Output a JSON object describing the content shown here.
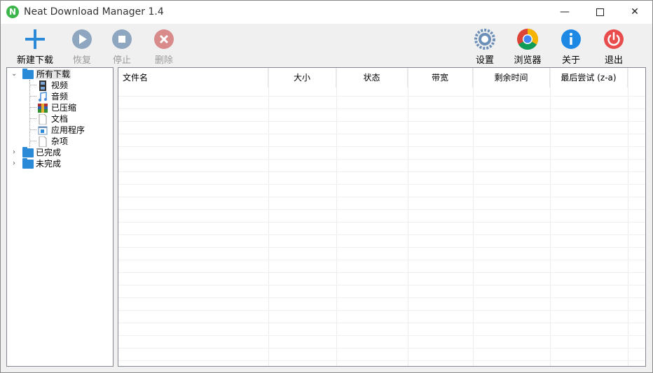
{
  "window": {
    "title": "Neat Download Manager 1.4",
    "app_icon_letter": "N",
    "controls": {
      "minimize": "—",
      "close": "✕"
    }
  },
  "toolbar": {
    "new_download": "新建下载",
    "resume": "恢复",
    "stop": "停止",
    "delete": "删除",
    "settings": "设置",
    "browser": "浏览器",
    "about": "关于",
    "exit": "退出"
  },
  "tree": {
    "all_downloads": "所有下载",
    "children": [
      "视频",
      "音频",
      "已压缩",
      "文档",
      "应用程序",
      "杂项"
    ],
    "completed": "已完成",
    "incomplete": "未完成"
  },
  "list": {
    "columns": [
      "文件名",
      "大小",
      "状态",
      "带宽",
      "剩余时间",
      "最后尝试 (z-a)"
    ]
  },
  "colors": {
    "accent_blue": "#2b8ad8",
    "disabled_icon": "#8fa6c0",
    "delete_red": "#d9534f",
    "exit_red": "#e84c4c",
    "info_blue": "#1e88e5"
  }
}
